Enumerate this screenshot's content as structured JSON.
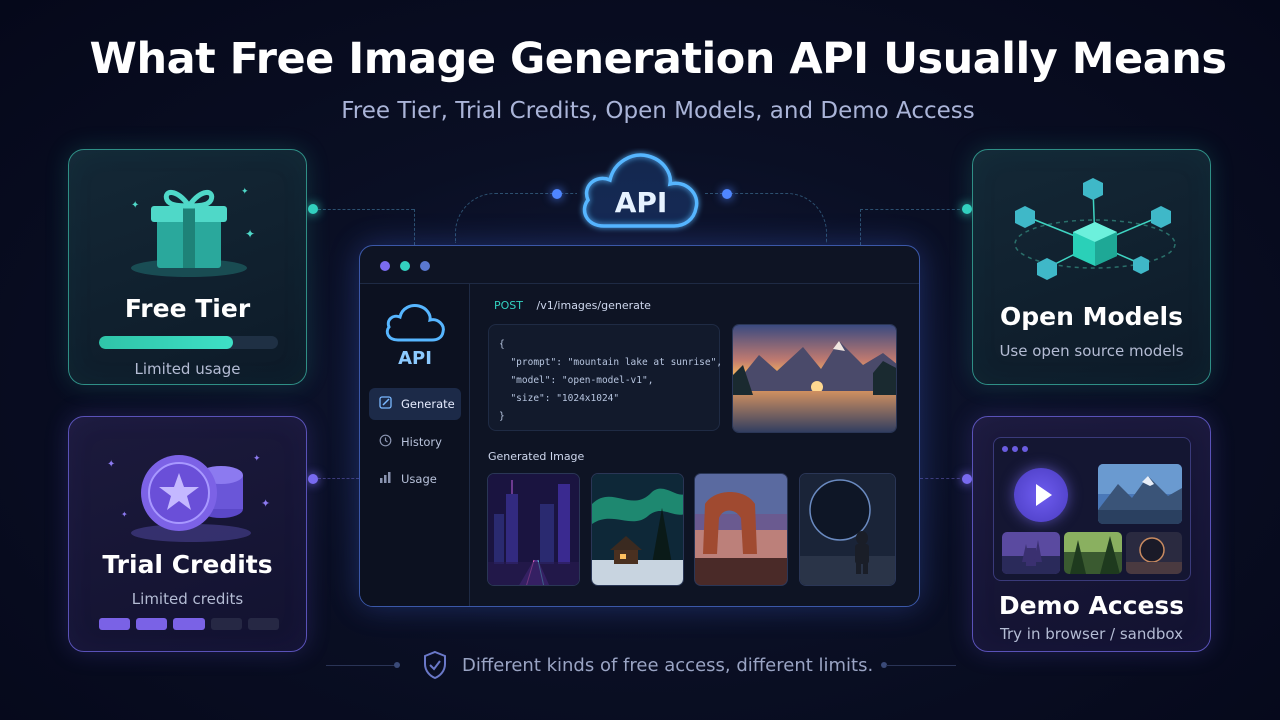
{
  "title": "What Free Image Generation API Usually Means",
  "subtitle": "Free Tier, Trial Credits, Open Models, and Demo Access",
  "cloud_label": "API",
  "cards": {
    "free_tier": {
      "title": "Free Tier",
      "sub": "Limited usage",
      "progress": 0.75,
      "icon": "gift-icon"
    },
    "trial_credits": {
      "title": "Trial Credits",
      "sub": "Limited credits",
      "credits_filled": 3,
      "credits_total": 5,
      "icon": "coin-stack-icon"
    },
    "open_models": {
      "title": "Open Models",
      "sub": "Use open source models",
      "icon": "network-cubes-icon"
    },
    "demo_access": {
      "title": "Demo Access",
      "sub": "Try in browser / sandbox",
      "icon": "play-icon"
    }
  },
  "window": {
    "brand": "API",
    "nav": [
      {
        "label": "Generate",
        "icon": "edit-icon",
        "active": true
      },
      {
        "label": "History",
        "icon": "clock-icon",
        "active": false
      },
      {
        "label": "Usage",
        "icon": "bar-chart-icon",
        "active": false
      }
    ],
    "method": "POST",
    "endpoint": "/v1/images/generate",
    "code_lines": [
      "{",
      "  \"prompt\": \"mountain lake at sunrise\",",
      "  \"model\": \"open-model-v1\",",
      "  \"size\": \"1024x1024\"",
      "}"
    ],
    "generated_label": "Generated Image"
  },
  "footer": "Different kinds of free access, different limits.",
  "colors": {
    "teal": "#33d1c0",
    "purple": "#7a6cf0",
    "blue": "#4f86ff"
  }
}
